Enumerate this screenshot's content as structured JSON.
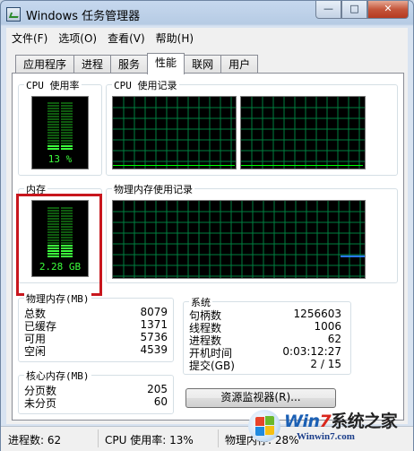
{
  "window": {
    "title": "Windows 任务管理器",
    "controls": {
      "minimize": "—",
      "maximize": "□",
      "close": "✕"
    }
  },
  "menu": [
    "文件(F)",
    "选项(O)",
    "查看(V)",
    "帮助(H)"
  ],
  "tabs": [
    "应用程序",
    "进程",
    "服务",
    "性能",
    "联网",
    "用户"
  ],
  "active_tab": "性能",
  "cpu": {
    "label": "CPU 使用率",
    "value": "13 %",
    "usage_fraction": 0.13,
    "history_label": "CPU 使用记录"
  },
  "memory": {
    "label": "内存",
    "value": "2.28 GB",
    "usage_fraction": 0.28,
    "history_label": "物理内存使用记录"
  },
  "physical_memory": {
    "label": "物理内存(MB)",
    "rows": [
      {
        "k": "总数",
        "v": "8079"
      },
      {
        "k": "已缓存",
        "v": "1371"
      },
      {
        "k": "可用",
        "v": "5736"
      },
      {
        "k": "空闲",
        "v": "4539"
      }
    ]
  },
  "kernel_memory": {
    "label": "核心内存(MB)",
    "rows": [
      {
        "k": "分页数",
        "v": "205"
      },
      {
        "k": "未分页",
        "v": "60"
      }
    ]
  },
  "system": {
    "label": "系统",
    "rows": [
      {
        "k": "句柄数",
        "v": "1256603"
      },
      {
        "k": "线程数",
        "v": "1006"
      },
      {
        "k": "进程数",
        "v": "62"
      },
      {
        "k": "开机时间",
        "v": "0:03:12:27"
      },
      {
        "k": "提交(GB)",
        "v": "2 / 15"
      }
    ]
  },
  "resource_monitor_button": "资源监视器(R)...",
  "statusbar": {
    "processes": "进程数: 62",
    "cpu": "CPU 使用率: 13%",
    "memory": "物理内存: 28%"
  },
  "watermark": {
    "win": "Win",
    "seven": "7",
    "cn": "系统之家",
    "url": "Winwin7.com"
  },
  "colors": {
    "grid": "#008040",
    "line": "#00ff00",
    "meter_on": "#3cff3c",
    "meter_off": "#0f5a0f",
    "mem_line": "#2b7fff"
  }
}
